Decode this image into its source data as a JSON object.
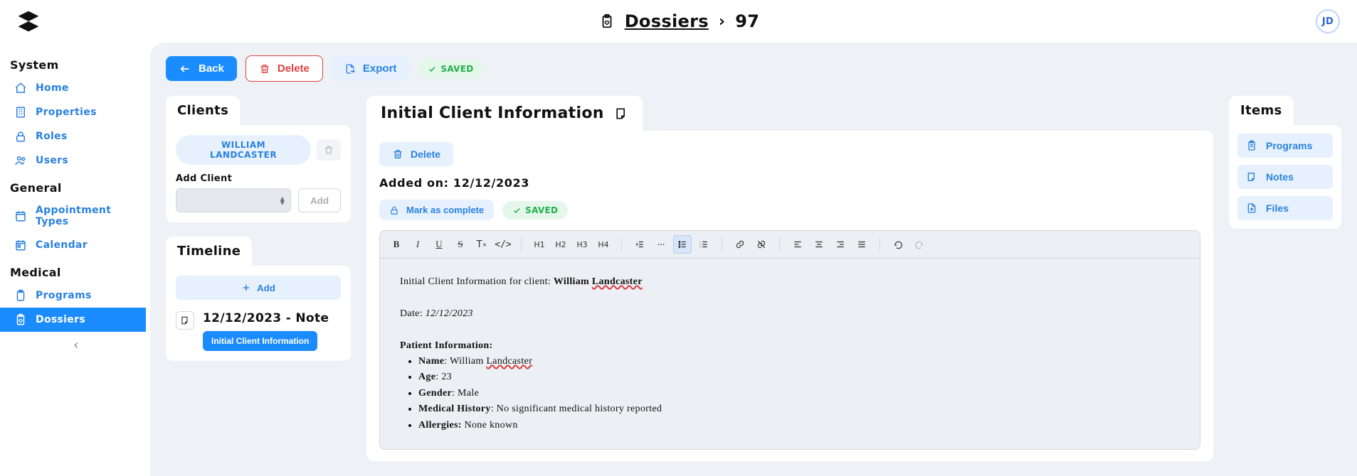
{
  "app": {
    "user_initials": "JD"
  },
  "breadcrumb": {
    "root": "Dossiers",
    "sep": "›",
    "id": "97"
  },
  "sidebar": {
    "groups": [
      {
        "title": "System",
        "items": [
          {
            "label": "Home",
            "icon": "home-icon"
          },
          {
            "label": "Properties",
            "icon": "building-icon"
          },
          {
            "label": "Roles",
            "icon": "lock-icon"
          },
          {
            "label": "Users",
            "icon": "users-icon"
          }
        ]
      },
      {
        "title": "General",
        "items": [
          {
            "label": "Appointment Types",
            "icon": "calendar-icon"
          },
          {
            "label": "Calendar",
            "icon": "calendar2-icon"
          }
        ]
      },
      {
        "title": "Medical",
        "items": [
          {
            "label": "Programs",
            "icon": "clipboard-icon"
          },
          {
            "label": "Dossiers",
            "icon": "clipboard-heart-icon",
            "active": true
          }
        ]
      }
    ]
  },
  "toolbar": {
    "back": "Back",
    "delete": "Delete",
    "export": "Export",
    "saved": "SAVED"
  },
  "clients": {
    "tab": "Clients",
    "chip": "WILLIAM LANDCASTER",
    "add_label": "Add Client",
    "add_btn": "Add"
  },
  "timeline": {
    "tab": "Timeline",
    "add": "Add",
    "item": {
      "title": "12/12/2023 - Note",
      "note_btn": "Initial Client Information"
    }
  },
  "mid": {
    "tab": "Initial Client Information",
    "delete": "Delete",
    "added_on_label": "Added on: ",
    "added_on_date": "12/12/2023",
    "mark_complete": "Mark as complete",
    "saved": "SAVED"
  },
  "doc": {
    "l1_pre": "Initial Client Information for client: ",
    "l1_name": "William ",
    "l1_name2": "Landcaster",
    "l2_pre": "Date: ",
    "l2_date": "12/12/2023",
    "sec": "Patient Information:",
    "name_k": "Name",
    "name_v1": ": William ",
    "name_v2": "Landcaster",
    "age_k": "Age",
    "age_v": ": 23",
    "gender_k": "Gender",
    "gender_v": ": Male",
    "mh_k": "Medical History",
    "mh_v": ": No significant medical history reported",
    "al_k": "Allergies:",
    "al_v": " None known"
  },
  "right": {
    "tab": "Items",
    "programs": "Programs",
    "notes": "Notes",
    "files": "Files"
  }
}
